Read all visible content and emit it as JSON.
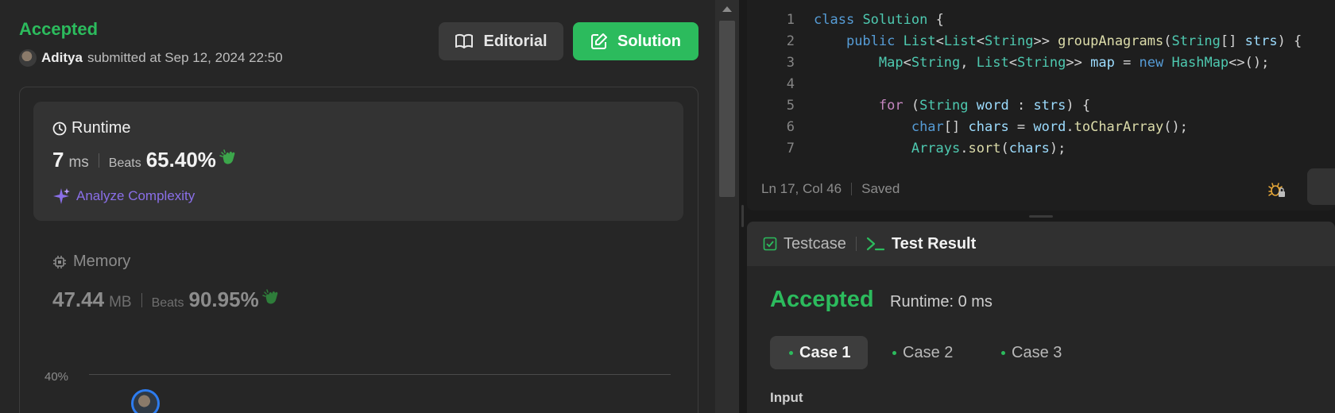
{
  "submission": {
    "status": "Accepted",
    "author": "Aditya",
    "submitted_text": "submitted at Sep 12, 2024 22:50"
  },
  "buttons": {
    "editorial": "Editorial",
    "solution": "Solution"
  },
  "runtime": {
    "title": "Runtime",
    "value": "7",
    "unit": "ms",
    "beats_label": "Beats",
    "beats_pct": "65.40%",
    "analyze_label": "Analyze Complexity"
  },
  "memory": {
    "title": "Memory",
    "value": "47.44",
    "unit": "MB",
    "beats_label": "Beats",
    "beats_pct": "90.95%"
  },
  "distribution_chart": {
    "y_tick": "40%"
  },
  "editor": {
    "lines": [
      {
        "num": "1",
        "text": "class Solution {"
      },
      {
        "num": "2",
        "text": "    public List<List<String>> groupAnagrams(String[] strs) {"
      },
      {
        "num": "3",
        "text": "        Map<String, List<String>> map = new HashMap<>();"
      },
      {
        "num": "4",
        "text": ""
      },
      {
        "num": "5",
        "text": "        for (String word : strs) {"
      },
      {
        "num": "6",
        "text": "            char[] chars = word.toCharArray();"
      },
      {
        "num": "7",
        "text": "            Arrays.sort(chars);"
      }
    ],
    "cursor_position": "Ln 17, Col 46",
    "save_state": "Saved"
  },
  "test_panel": {
    "tab_testcase": "Testcase",
    "tab_result": "Test Result",
    "status": "Accepted",
    "runtime": "Runtime: 0 ms",
    "cases": [
      "Case 1",
      "Case 2",
      "Case 3"
    ],
    "input_label": "Input"
  },
  "colors": {
    "accepted_green": "#2cbb5d",
    "analyze_purple": "#8a6fe8",
    "keyword_blue": "#569cd6",
    "type_teal": "#4ec9b0"
  }
}
